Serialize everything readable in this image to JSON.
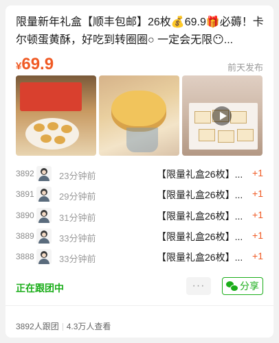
{
  "post": {
    "title": "限量新年礼盒【顺丰包邮】26枚💰69.9🎁必薅！卡尔顿蛋黄酥，好吃到转圈圈○ 一定会无限😶...",
    "price_symbol": "¥",
    "price_value": "69.9",
    "posted_time": "前天发布"
  },
  "thumbnails": [
    {
      "icon": "product-photo"
    },
    {
      "icon": "product-photo"
    },
    {
      "icon": "video-thumbnail",
      "has_play": true
    }
  ],
  "orders": [
    {
      "number": "3892",
      "time": "23分钟前",
      "desc": "【限量礼盒26枚】...",
      "increment": "+1"
    },
    {
      "number": "3891",
      "time": "29分钟前",
      "desc": "【限量礼盒26枚】...",
      "increment": "+1"
    },
    {
      "number": "3890",
      "time": "31分钟前",
      "desc": "【限量礼盒26枚】...",
      "increment": "+1"
    },
    {
      "number": "3889",
      "time": "33分钟前",
      "desc": "【限量礼盒26枚】...",
      "increment": "+1"
    },
    {
      "number": "3888",
      "time": "33分钟前",
      "desc": "【限量礼盒26枚】...",
      "increment": "+1"
    }
  ],
  "actions": {
    "status": "正在跟团中",
    "more_label": "···",
    "share_label": "分享"
  },
  "footer": {
    "participants": "3892人跟团",
    "views": "4.3万人查看"
  },
  "colors": {
    "accent_orange": "#f05a24",
    "brand_green": "#1aad19",
    "muted_text": "#9a9a9a"
  }
}
